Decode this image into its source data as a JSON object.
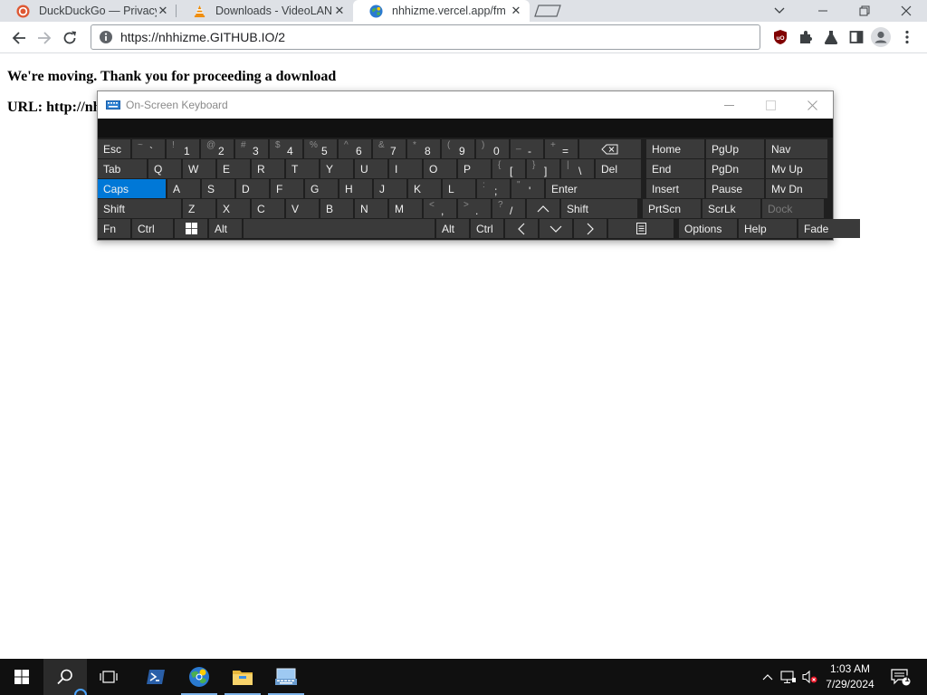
{
  "browser": {
    "tabs": [
      {
        "title": "DuckDuckGo — Privacy, simplified.",
        "icon": "duckduckgo-icon",
        "active": false
      },
      {
        "title": "Downloads - VideoLAN",
        "icon": "vlc-cone-icon",
        "active": false
      },
      {
        "title": "nhhizme.vercel.app/fm",
        "icon": "globe-favicon-icon",
        "active": true
      }
    ],
    "close_glyph": "✕",
    "address": "https://nhhizme.GITHUB.IO/2"
  },
  "page": {
    "line1": "We're moving. Thank you for proceeding a download",
    "line2": "URL: http://nh"
  },
  "osk": {
    "title": "On-Screen Keyboard",
    "rows": [
      [
        {
          "label": "Esc"
        },
        {
          "shift": "~",
          "primary": "`"
        },
        {
          "shift": "!",
          "primary": "1"
        },
        {
          "shift": "@",
          "primary": "2"
        },
        {
          "shift": "#",
          "primary": "3"
        },
        {
          "shift": "$",
          "primary": "4"
        },
        {
          "shift": "%",
          "primary": "5"
        },
        {
          "shift": "^",
          "primary": "6"
        },
        {
          "shift": "&",
          "primary": "7"
        },
        {
          "shift": "*",
          "primary": "8"
        },
        {
          "shift": "(",
          "primary": "9"
        },
        {
          "shift": ")",
          "primary": "0"
        },
        {
          "shift": "_",
          "primary": "-"
        },
        {
          "shift": "+",
          "primary": "="
        },
        {
          "icon": "backspace-icon"
        },
        {
          "label": "Home"
        },
        {
          "label": "PgUp"
        },
        {
          "label": "Nav"
        }
      ],
      [
        {
          "label": "Tab"
        },
        {
          "label": "Q"
        },
        {
          "label": "W"
        },
        {
          "label": "E"
        },
        {
          "label": "R"
        },
        {
          "label": "T"
        },
        {
          "label": "Y"
        },
        {
          "label": "U"
        },
        {
          "label": "I"
        },
        {
          "label": "O"
        },
        {
          "label": "P"
        },
        {
          "shift": "{",
          "primary": "["
        },
        {
          "shift": "}",
          "primary": "]"
        },
        {
          "shift": "|",
          "primary": "\\"
        },
        {
          "label": "Del"
        },
        {
          "label": "End"
        },
        {
          "label": "PgDn"
        },
        {
          "label": "Mv Up"
        }
      ],
      [
        {
          "label": "Caps",
          "active": true
        },
        {
          "label": "A"
        },
        {
          "label": "S"
        },
        {
          "label": "D"
        },
        {
          "label": "F"
        },
        {
          "label": "G"
        },
        {
          "label": "H"
        },
        {
          "label": "J"
        },
        {
          "label": "K"
        },
        {
          "label": "L"
        },
        {
          "shift": ":",
          "primary": ";"
        },
        {
          "shift": "\"",
          "primary": "'"
        },
        {
          "label": "Enter"
        },
        {
          "label": "Insert"
        },
        {
          "label": "Pause"
        },
        {
          "label": "Mv Dn"
        }
      ],
      [
        {
          "label": "Shift"
        },
        {
          "label": "Z"
        },
        {
          "label": "X"
        },
        {
          "label": "C"
        },
        {
          "label": "V"
        },
        {
          "label": "B"
        },
        {
          "label": "N"
        },
        {
          "label": "M"
        },
        {
          "shift": "<",
          "primary": ","
        },
        {
          "shift": ">",
          "primary": "."
        },
        {
          "shift": "?",
          "primary": "/"
        },
        {
          "icon": "arrow-up-icon"
        },
        {
          "label": "Shift"
        },
        {
          "label": "PrtScn"
        },
        {
          "label": "ScrLk"
        },
        {
          "label": "Dock",
          "dim": true
        }
      ],
      [
        {
          "label": "Fn"
        },
        {
          "label": "Ctrl"
        },
        {
          "icon": "windows-logo-icon"
        },
        {
          "label": "Alt"
        },
        {
          "icon": "space-bar"
        },
        {
          "label": "Alt"
        },
        {
          "label": "Ctrl"
        },
        {
          "icon": "arrow-left-icon"
        },
        {
          "icon": "arrow-down-icon"
        },
        {
          "icon": "arrow-right-icon"
        },
        {
          "icon": "context-menu-icon"
        },
        {
          "label": "Options"
        },
        {
          "label": "Help"
        },
        {
          "label": "Fade"
        }
      ]
    ]
  },
  "taskbar": {
    "time": "1:03 AM",
    "date": "7/29/2024",
    "notification_count": "1"
  },
  "colors": {
    "accent": "#0078d7",
    "osk_key": "#3a3a3a",
    "osk_bg": "#1f1f1f",
    "taskbar": "#101010"
  }
}
